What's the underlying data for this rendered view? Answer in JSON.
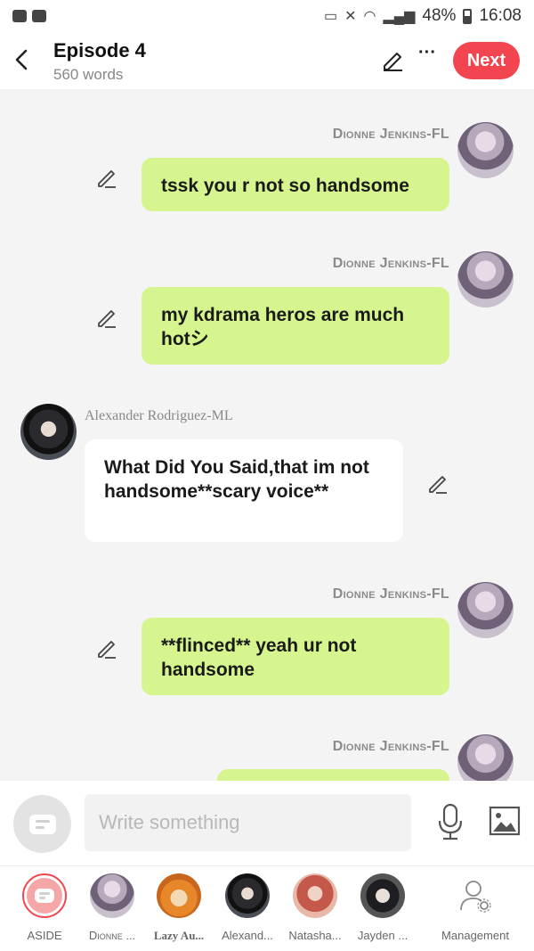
{
  "status_bar": {
    "battery": "48%",
    "time": "16:08"
  },
  "header": {
    "title": "Episode 4",
    "word_count": "560 words",
    "more": "···",
    "next_label": "Next"
  },
  "messages": [
    {
      "speaker": "Dionne Jenkins-FL",
      "side": "right",
      "text": "tssk you r not so handsome"
    },
    {
      "speaker": "Dionne Jenkins-FL",
      "side": "right",
      "text": "my kdrama heros are much hotシ"
    },
    {
      "speaker": "Alexander Rodriguez-ML",
      "side": "left",
      "text": "What Did You Said,that im not handsome**scary voice**"
    },
    {
      "speaker": "Dionne Jenkins-FL",
      "side": "right",
      "text": "**flinced** yeah ur not handsome"
    },
    {
      "speaker": "Dionne Jenkins-FL",
      "side": "right",
      "text": ""
    }
  ],
  "composer": {
    "placeholder": "Write something"
  },
  "characters": [
    {
      "label": "ASIDE"
    },
    {
      "label": "Dionne ..."
    },
    {
      "label": "Lazy Au..."
    },
    {
      "label": "Alexand..."
    },
    {
      "label": "Natasha..."
    },
    {
      "label": "Jayden ..."
    },
    {
      "label": "Management"
    }
  ],
  "colors": {
    "accent": "#f2454f",
    "bubble_green": "#d7f58e",
    "bubble_white": "#ffffff"
  },
  "icons": [
    "back-icon",
    "pencil-icon",
    "more-icon",
    "chat-icon",
    "mic-icon",
    "image-icon",
    "user-gear-icon"
  ]
}
